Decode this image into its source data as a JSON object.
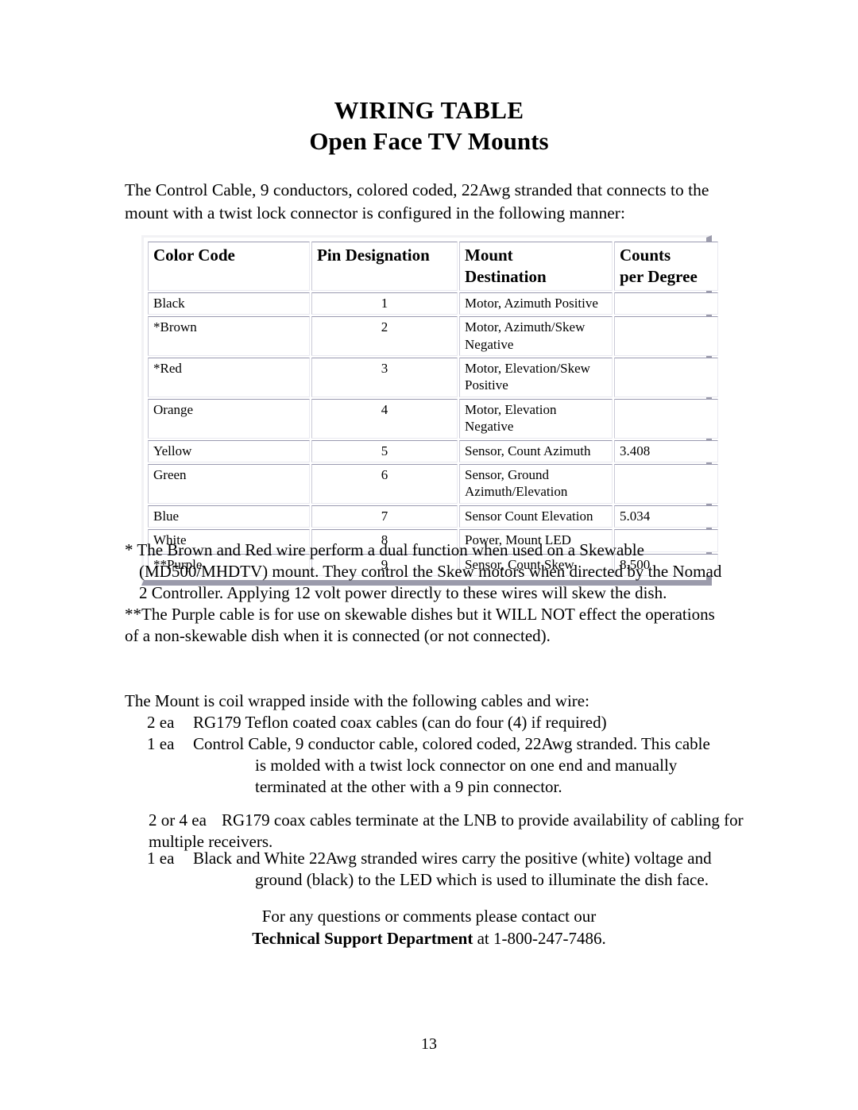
{
  "document": {
    "title_main": "WIRING TABLE",
    "title_sub": "Open Face TV Mounts",
    "intro": "The Control Cable, 9 conductors, colored coded, 22Awg stranded that connects to the mount with a twist lock connector is configured in the following manner:",
    "page_number": "13"
  },
  "wiring_table": {
    "headers": {
      "color_code": "Color Code",
      "pin_designation": "Pin Designation",
      "mount_destination_line1": "Mount",
      "mount_destination_line2": "Destination",
      "counts_line1": "Counts",
      "counts_line2": "per Degree"
    },
    "rows": [
      {
        "color": "Black",
        "pin": "1",
        "destination_line1": "Motor, Azimuth Positive",
        "destination_line2": "",
        "counts": ""
      },
      {
        "color": "*Brown",
        "pin": "2",
        "destination_line1": "Motor, Azimuth/Skew",
        "destination_line2": "Negative",
        "counts": ""
      },
      {
        "color": "*Red",
        "pin": "3",
        "destination_line1": "Motor, Elevation/Skew",
        "destination_line2": "Positive",
        "counts": ""
      },
      {
        "color": "Orange",
        "pin": "4",
        "destination_line1": "Motor, Elevation",
        "destination_line2": "Negative",
        "counts": ""
      },
      {
        "color": "Yellow",
        "pin": "5",
        "destination_line1": "Sensor, Count Azimuth",
        "destination_line2": "",
        "counts": "3.408"
      },
      {
        "color": "Green",
        "pin": "6",
        "destination_line1": "Sensor, Ground",
        "destination_line2": "Azimuth/Elevation",
        "counts": ""
      },
      {
        "color": "Blue",
        "pin": "7",
        "destination_line1": "Sensor Count Elevation",
        "destination_line2": "",
        "counts": "5.034"
      },
      {
        "color": "White",
        "pin": "8",
        "destination_line1": "Power, Mount LED",
        "destination_line2": "",
        "counts": ""
      },
      {
        "color": "**Purple",
        "pin": "9",
        "destination_line1": "Sensor, Count Skew",
        "destination_line2": "",
        "counts": "8.500"
      }
    ]
  },
  "footnotes": {
    "single_star": "* The Brown and Red wire perform a dual function when used on a Skewable (MD500/MHDTV) mount.  They control the Skew motors when directed by the Nomad 2 Controller.  Applying 12 volt power directly to these wires will skew the dish.",
    "double_star": "**The Purple cable is for use on skewable dishes but it WILL NOT effect the operations of a non-skewable dish when it is connected (or not connected)."
  },
  "mount_section": {
    "lead_in": "The Mount is coil wrapped inside with the following cables and wire:",
    "items": [
      {
        "qty": "2 ea",
        "desc": "RG179 Teflon coated coax cables (can do four (4) if required)",
        "continuation": ""
      },
      {
        "qty": "1 ea",
        "desc": "Control Cable, 9 conductor cable, colored coded, 22Awg stranded.  This cable",
        "continuation": "is molded with a twist lock connector on one end and manually terminated at the other with a 9 pin connector."
      }
    ]
  },
  "lnb_section": {
    "qty": "2 or 4 ea",
    "text": "RG179 coax cables terminate at the LNB to provide availability of cabling for multiple receivers."
  },
  "led_section": {
    "qty": "1 ea",
    "desc": "Black and White 22Awg stranded wires carry the positive (white) voltage and",
    "continuation": "ground (black) to the LED which is used to illuminate the dish face."
  },
  "contact": {
    "line1": "For any questions or comments please contact our",
    "dept": "Technical Support Department",
    "phone_suffix": " at 1-800-247-7486."
  }
}
